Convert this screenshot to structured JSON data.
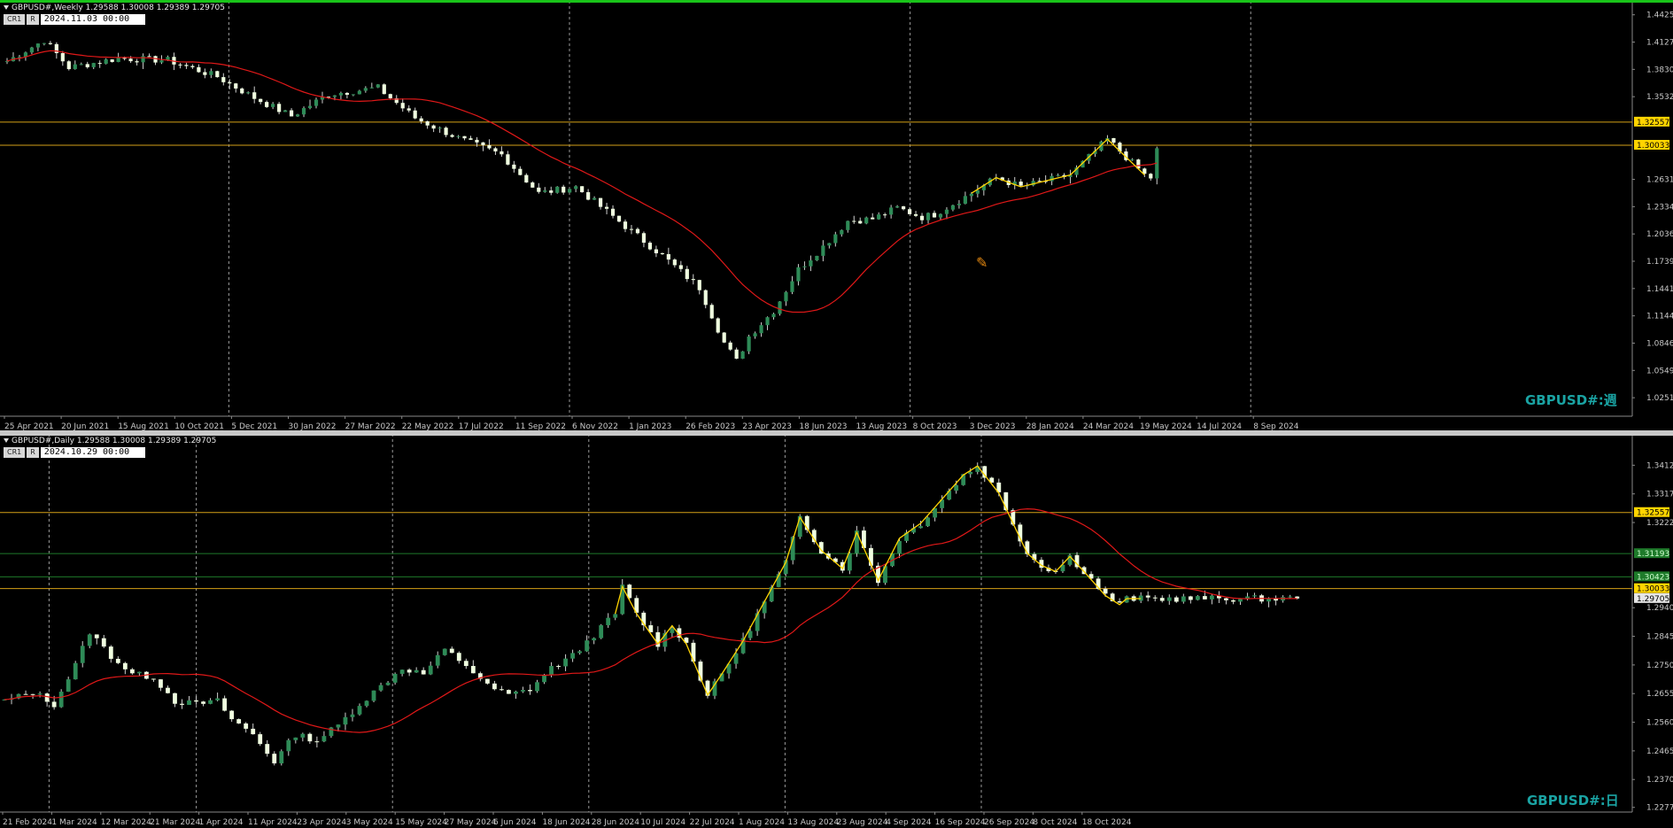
{
  "colors": {
    "background": "#000000",
    "bull": "#2e8b57",
    "bear": "#f0ffe0",
    "wick": "#cfcfcf",
    "ma": "#e01818",
    "zigzag": "#ffd400",
    "level": "#d4a017",
    "level_green": "#1e7a2a",
    "grid": "#9a9a9a",
    "axis_text": "#c8c8c8",
    "watermark": "#1aa3a3"
  },
  "panes": [
    {
      "id": "weekly",
      "header": "GBPUSD#,Weekly  1.29588 1.30008 1.29389 1.29705",
      "toolbar": {
        "cr1": "CR1",
        "r": "R",
        "datetime": "2024.11.03 00:00"
      },
      "watermark": "GBPUSD#:週",
      "cursor_icon": "crosshair-pencil-icon"
    },
    {
      "id": "daily",
      "header": "GBPUSD#,Daily  1.29588 1.30008 1.29389 1.29705",
      "toolbar": {
        "cr1": "CR1",
        "r": "R",
        "datetime": "2024.10.29 00:00"
      },
      "watermark": "GBPUSD#:日"
    }
  ],
  "chart_data": [
    {
      "type": "candlestick",
      "title": "GBPUSD#,Weekly",
      "ylim": [
        1.005,
        1.448
      ],
      "yticks": [
        "1.44250",
        "1.41275",
        "1.38300",
        "1.35325",
        "1.26315",
        "1.23340",
        "1.20365",
        "1.17390",
        "1.14415",
        "1.11440",
        "1.08465",
        "1.05490",
        "1.02515"
      ],
      "price_labels": [
        {
          "text": "1.32557",
          "value": 1.32557,
          "kind": "level"
        },
        {
          "text": "1.30033",
          "value": 1.30033,
          "kind": "level"
        }
      ],
      "xticks": [
        "25 Apr 2021",
        "20 Jun 2021",
        "15 Aug 2021",
        "10 Oct 2021",
        "5 Dec 2021",
        "30 Jan 2022",
        "27 Mar 2022",
        "22 May 2022",
        "17 Jul 2022",
        "11 Sep 2022",
        "6 Nov 2022",
        "1 Jan 2023",
        "26 Feb 2023",
        "23 Apr 2023",
        "18 Jun 2023",
        "13 Aug 2023",
        "8 Oct 2023",
        "3 Dec 2023",
        "28 Jan 2024",
        "24 Mar 2024",
        "19 May 2024",
        "14 Jul 2024",
        "8 Sep 2024"
      ],
      "vlines_after_tick": [
        4,
        10,
        16,
        22
      ],
      "bars": 187,
      "anchors": [
        [
          0,
          1.392
        ],
        [
          6,
          1.415
        ],
        [
          10,
          1.385
        ],
        [
          18,
          1.395
        ],
        [
          26,
          1.393
        ],
        [
          34,
          1.375
        ],
        [
          40,
          1.352
        ],
        [
          46,
          1.332
        ],
        [
          52,
          1.356
        ],
        [
          60,
          1.363
        ],
        [
          66,
          1.33
        ],
        [
          74,
          1.305
        ],
        [
          80,
          1.29
        ],
        [
          86,
          1.248
        ],
        [
          92,
          1.255
        ],
        [
          100,
          1.212
        ],
        [
          106,
          1.18
        ],
        [
          112,
          1.145
        ],
        [
          116,
          1.085
        ],
        [
          118,
          1.065
        ],
        [
          120,
          1.092
        ],
        [
          124,
          1.12
        ],
        [
          128,
          1.165
        ],
        [
          132,
          1.19
        ],
        [
          136,
          1.218
        ],
        [
          140,
          1.22
        ],
        [
          144,
          1.232
        ],
        [
          148,
          1.222
        ],
        [
          150,
          1.225
        ],
        [
          156,
          1.248
        ],
        [
          160,
          1.265
        ],
        [
          164,
          1.255
        ],
        [
          172,
          1.268
        ],
        [
          178,
          1.307
        ],
        [
          184,
          1.268
        ],
        [
          190,
          1.25
        ],
        [
          196,
          1.232
        ],
        [
          200,
          1.24
        ],
        [
          206,
          1.275
        ],
        [
          212,
          1.272
        ],
        [
          218,
          1.266
        ],
        [
          222,
          1.28
        ],
        [
          228,
          1.262
        ],
        [
          234,
          1.258
        ],
        [
          240,
          1.275
        ],
        [
          246,
          1.272
        ],
        [
          252,
          1.256
        ],
        [
          256,
          1.297
        ],
        [
          262,
          1.285
        ],
        [
          268,
          1.313
        ],
        [
          274,
          1.3
        ],
        [
          278,
          1.302
        ]
      ],
      "ma_period": 20,
      "zigzag_from": 153,
      "levels": [
        1.32557,
        1.30033
      ],
      "last_close": 1.29705,
      "watermark": "GBPUSD#:週"
    },
    {
      "type": "candlestick",
      "title": "GBPUSD#,Daily",
      "ylim": [
        1.2262,
        1.3487
      ],
      "yticks": [
        "1.34125",
        "1.33175",
        "1.32225",
        "1.29400",
        "1.28450",
        "1.27500",
        "1.26550",
        "1.25600",
        "1.24650",
        "1.23700",
        "1.22775"
      ],
      "price_labels": [
        {
          "text": "1.32557",
          "value": 1.32557,
          "kind": "level"
        },
        {
          "text": "1.31193",
          "value": 1.31193,
          "kind": "green"
        },
        {
          "text": "1.30423",
          "value": 1.30423,
          "kind": "green"
        },
        {
          "text": "1.30033",
          "value": 1.30033,
          "kind": "level"
        },
        {
          "text": "1.29705",
          "value": 1.29705,
          "kind": "last"
        }
      ],
      "xticks": [
        "21 Feb 2024",
        "1 Mar 2024",
        "12 Mar 2024",
        "21 Mar 2024",
        "1 Apr 2024",
        "11 Apr 2024",
        "23 Apr 2024",
        "3 May 2024",
        "15 May 2024",
        "27 May 2024",
        "6 Jun 2024",
        "18 Jun 2024",
        "28 Jun 2024",
        "10 Jul 2024",
        "22 Jul 2024",
        "1 Aug 2024",
        "13 Aug 2024",
        "23 Aug 2024",
        "4 Sep 2024",
        "16 Sep 2024",
        "26 Sep 2024",
        "8 Oct 2024",
        "18 Oct 2024"
      ],
      "vlines_after_tick": [
        1,
        4,
        8,
        12,
        16,
        20
      ],
      "bars": 183,
      "anchors": [
        [
          0,
          1.263
        ],
        [
          4,
          1.266
        ],
        [
          7,
          1.262
        ],
        [
          10,
          1.275
        ],
        [
          12,
          1.286
        ],
        [
          15,
          1.278
        ],
        [
          18,
          1.272
        ],
        [
          21,
          1.271
        ],
        [
          24,
          1.263
        ],
        [
          27,
          1.262
        ],
        [
          30,
          1.263
        ],
        [
          32,
          1.257
        ],
        [
          35,
          1.252
        ],
        [
          38,
          1.243
        ],
        [
          41,
          1.252
        ],
        [
          44,
          1.25
        ],
        [
          47,
          1.255
        ],
        [
          50,
          1.262
        ],
        [
          53,
          1.268
        ],
        [
          56,
          1.274
        ],
        [
          59,
          1.272
        ],
        [
          62,
          1.28
        ],
        [
          65,
          1.275
        ],
        [
          68,
          1.268
        ],
        [
          71,
          1.265
        ],
        [
          74,
          1.267
        ],
        [
          77,
          1.274
        ],
        [
          80,
          1.278
        ],
        [
          83,
          1.285
        ],
        [
          86,
          1.292
        ],
        [
          87,
          1.301
        ],
        [
          89,
          1.292
        ],
        [
          92,
          1.282
        ],
        [
          94,
          1.288
        ],
        [
          96,
          1.282
        ],
        [
          99,
          1.265
        ],
        [
          101,
          1.272
        ],
        [
          104,
          1.283
        ],
        [
          107,
          1.296
        ],
        [
          110,
          1.309
        ],
        [
          112,
          1.324
        ],
        [
          115,
          1.313
        ],
        [
          118,
          1.307
        ],
        [
          120,
          1.319
        ],
        [
          123,
          1.303
        ],
        [
          126,
          1.317
        ],
        [
          129,
          1.322
        ],
        [
          132,
          1.33
        ],
        [
          135,
          1.338
        ],
        [
          137,
          1.341
        ],
        [
          140,
          1.332
        ],
        [
          142,
          1.322
        ],
        [
          144,
          1.312
        ],
        [
          146,
          1.308
        ],
        [
          148,
          1.306
        ],
        [
          150,
          1.311
        ],
        [
          152,
          1.306
        ],
        [
          155,
          1.298
        ],
        [
          157,
          1.295
        ],
        [
          158,
          1.297
        ],
        [
          160,
          1.297
        ]
      ],
      "ma_period": 20,
      "zigzag_from": 86,
      "levels": [
        1.32557,
        1.30033
      ],
      "green_levels": [
        1.31193,
        1.30423
      ],
      "last_close": 1.29705,
      "watermark": "GBPUSD#:日"
    }
  ]
}
